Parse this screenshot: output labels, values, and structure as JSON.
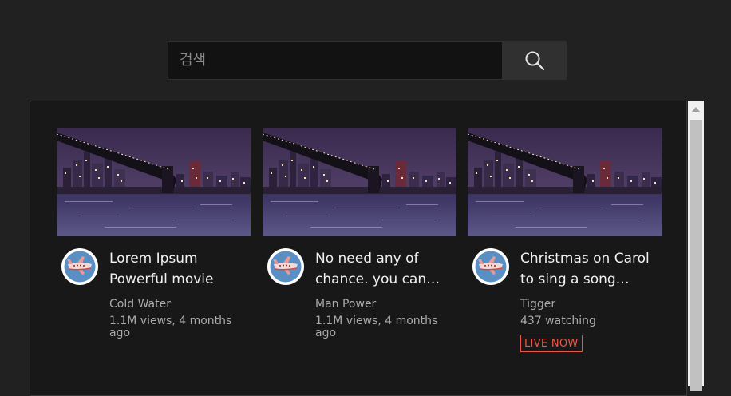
{
  "search": {
    "placeholder": "검색",
    "button_icon": "search-icon"
  },
  "videos": [
    {
      "title": "Lorem Ipsum Powerful movie",
      "channel": "Cold Water",
      "stats": "1.1M views, 4 months ago",
      "live": ""
    },
    {
      "title": "No need any of chance. you can see anything",
      "channel": "Man Power",
      "stats": "1.1M views, 4 months ago",
      "live": ""
    },
    {
      "title": "Christmas on Carol to sing a song together",
      "channel": "Tigger",
      "stats": "437 watching",
      "live": "LIVE NOW"
    }
  ],
  "colors": {
    "background": "#212121",
    "panel": "#181818",
    "live": "#e8584a"
  }
}
